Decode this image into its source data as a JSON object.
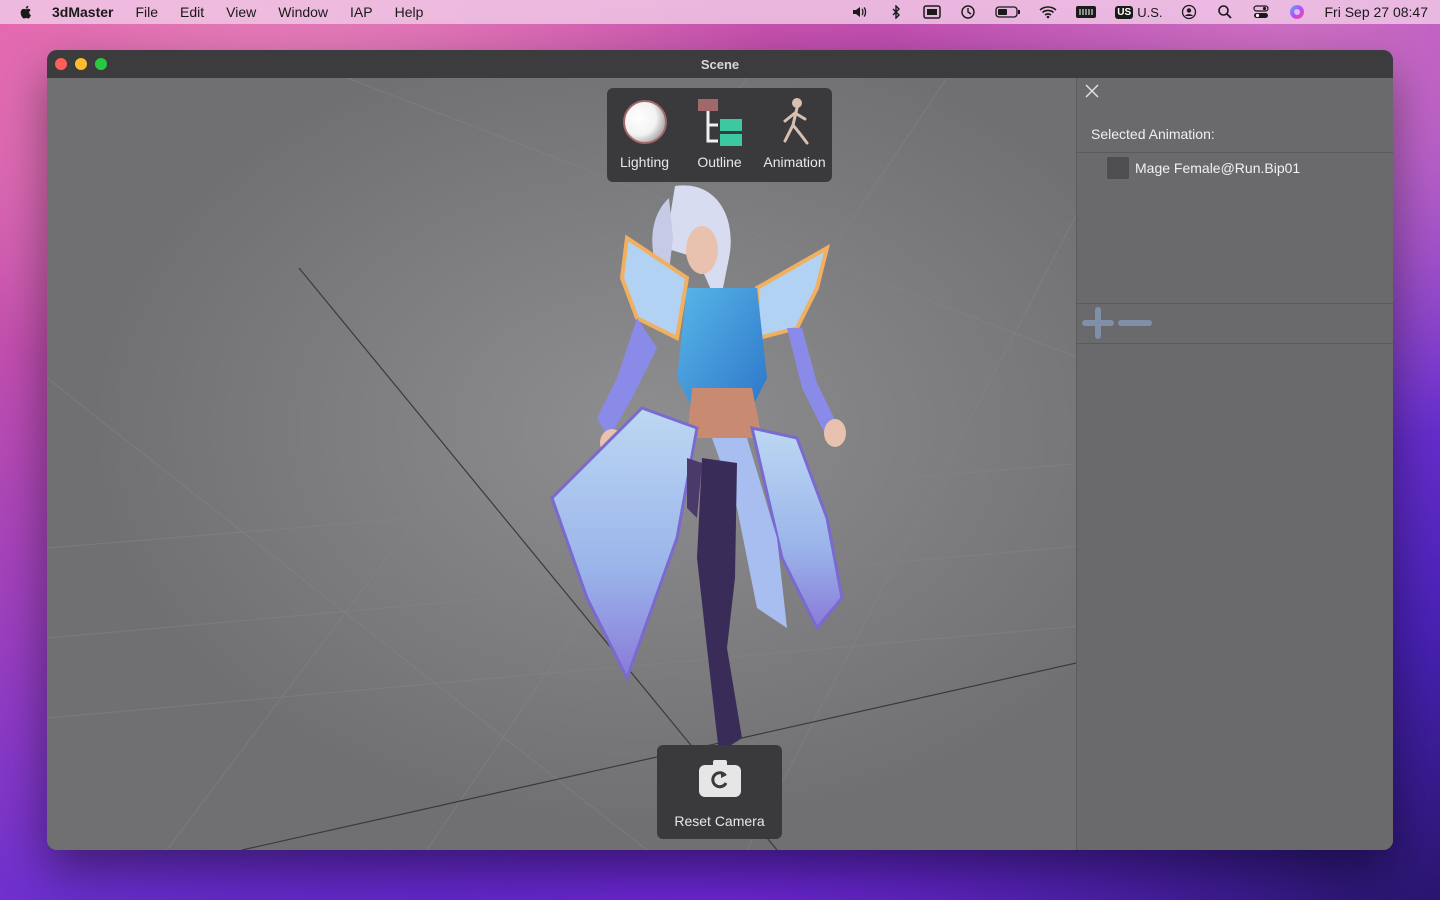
{
  "menubar": {
    "app_name": "3dMaster",
    "menus": [
      "File",
      "Edit",
      "View",
      "Window",
      "IAP",
      "Help"
    ],
    "input_source": "U.S.",
    "input_badge": "US",
    "datetime": "Fri Sep 27  08:47"
  },
  "window": {
    "title": "Scene"
  },
  "toolbar": {
    "items": [
      {
        "label": "Lighting",
        "icon": "lighting-sphere-icon"
      },
      {
        "label": "Outline",
        "icon": "outline-tree-icon"
      },
      {
        "label": "Animation",
        "icon": "animation-figure-icon"
      }
    ]
  },
  "panel": {
    "selected_label": "Selected Animation:",
    "animations": [
      {
        "name": "Mage Female@Run.Bip01",
        "checked": false
      }
    ]
  },
  "reset": {
    "label": "Reset Camera"
  },
  "colors": {
    "toolbar_bg": "#3a3a3c",
    "panel_bg": "#6a6a6c",
    "viewport_bg": "#7a7a7c",
    "outline_accent": "#3cc8a0",
    "outline_parent": "#a06868"
  }
}
